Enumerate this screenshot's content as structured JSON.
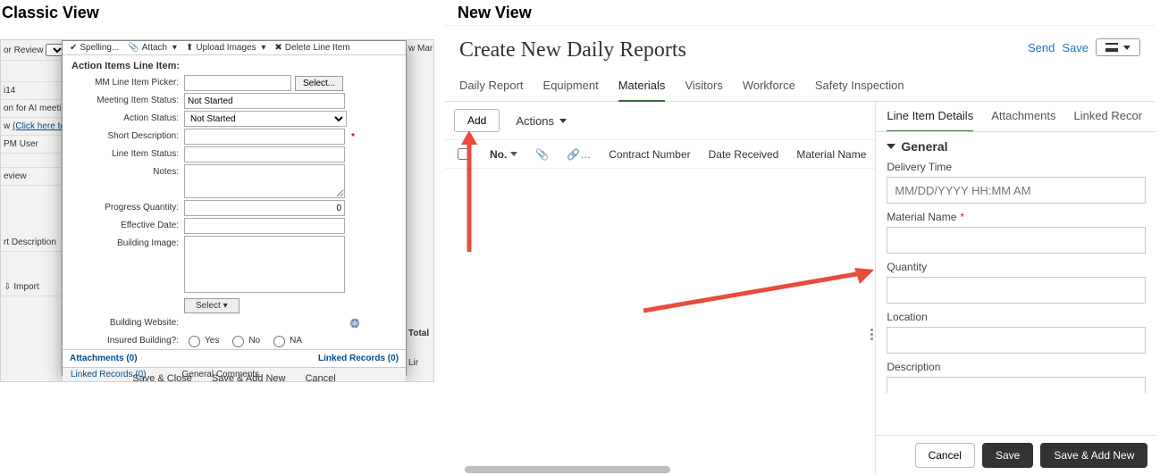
{
  "labels": {
    "classic": "Classic View",
    "newview": "New View"
  },
  "classic": {
    "toolbar": {
      "spelling": "Spelling...",
      "attach": "Attach",
      "upload": "Upload Images",
      "delete": "Delete Line Item"
    },
    "title": "Action Items Line Item:",
    "fields": {
      "picker_label": "MM Line Item Picker:",
      "select_btn": "Select...",
      "meeting_status_label": "Meeting Item Status:",
      "meeting_status_value": "Not Started",
      "action_status_label": "Action Status:",
      "action_status_value": "Not Started",
      "short_desc_label": "Short Description:",
      "line_status_label": "Line Item Status:",
      "notes_label": "Notes:",
      "progress_label": "Progress Quantity:",
      "progress_value": "0",
      "effective_label": "Effective Date:",
      "building_image_label": "Building Image:",
      "image_select": "Select",
      "building_website_label": "Building Website:",
      "insured_label": "Insured Building?:",
      "opt_yes": "Yes",
      "opt_no": "No",
      "opt_na": "NA"
    },
    "footer_links": {
      "attachments": "Attachments (0)",
      "linked": "Linked Records (0)"
    },
    "buttons": {
      "save_close": "Save & Close",
      "save_add": "Save & Add New",
      "cancel": "Cancel"
    },
    "bg": {
      "or_review": "or Review",
      "i14": "i14",
      "on_for_ai": "on for AI meeting",
      "click_here": "(Click here to",
      "pm_user": "PM User",
      "eview": "eview",
      "rt_desc": "rt Description",
      "import": "Import",
      "linked_records": "Linked Records (0)",
      "general_comments": "General Comments",
      "w_prefix": "w",
      "w_map": "w Mar",
      "total": "Total",
      "lir": "Lir"
    }
  },
  "newview": {
    "page_title": "Create New Daily Reports",
    "top_actions": {
      "send": "Send",
      "save": "Save"
    },
    "tabs": [
      "Daily Report",
      "Equipment",
      "Materials",
      "Visitors",
      "Workforce",
      "Safety Inspection"
    ],
    "active_tab_index": 2,
    "left_toolbar": {
      "add": "Add",
      "actions": "Actions"
    },
    "table": {
      "col_no": "No.",
      "col_contract": "Contract Number",
      "col_date": "Date Received",
      "col_material": "Material Name",
      "ellipsis": "…"
    },
    "right_tabs": [
      "Line Item Details",
      "Attachments",
      "Linked Recor"
    ],
    "right_active_index": 0,
    "section_general": "General",
    "fields": {
      "delivery_time": "Delivery Time",
      "delivery_placeholder": "MM/DD/YYYY HH:MM AM",
      "material_name": "Material Name",
      "quantity": "Quantity",
      "location": "Location",
      "description": "Description"
    },
    "footer": {
      "cancel": "Cancel",
      "save": "Save",
      "save_add": "Save & Add New"
    }
  }
}
